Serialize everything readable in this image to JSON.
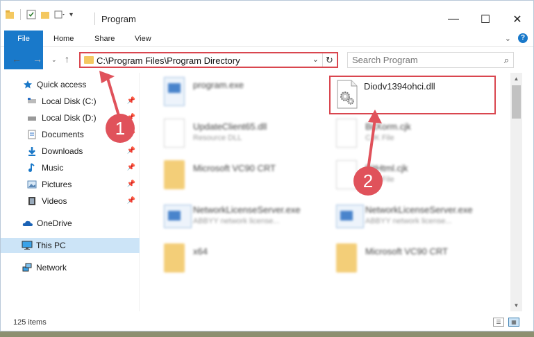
{
  "titlebar": {
    "title": "Program",
    "controls": {
      "minimize": "—",
      "maximize": "☐",
      "close": "✕"
    }
  },
  "ribbon": {
    "tabs": [
      "File",
      "Home",
      "Share",
      "View"
    ],
    "help": "?"
  },
  "address": {
    "path": "C:\\Program Files\\Program Directory",
    "refresh": "↻",
    "dropdown": "⌄"
  },
  "search": {
    "placeholder": "Search Program"
  },
  "sidebar": {
    "items": [
      {
        "label": "Quick access"
      },
      {
        "label": "Local Disk (C:)"
      },
      {
        "label": "Local Disk (D:)"
      },
      {
        "label": "Documents"
      },
      {
        "label": "Downloads"
      },
      {
        "label": "Music"
      },
      {
        "label": "Pictures"
      },
      {
        "label": "Videos"
      },
      {
        "label": "OneDrive"
      },
      {
        "label": "This PC"
      },
      {
        "label": "Network"
      }
    ]
  },
  "files": [
    {
      "name": "program.exe",
      "sub": ""
    },
    {
      "name": "Diodv1394ohci.dll",
      "sub": ""
    },
    {
      "name": "UpdateClient65.dll",
      "sub": "Resource DLL"
    },
    {
      "name": "BitXorm.cjk",
      "sub": "CJK File"
    },
    {
      "name": "Microsoft VC90 CRT",
      "sub": ""
    },
    {
      "name": "BitHtml.cjk",
      "sub": "CJK File"
    },
    {
      "name": "NetworkLicenseServer.exe",
      "sub": "ABBYY network license..."
    },
    {
      "name": "NetworkLicenseServer.exe",
      "sub": "ABBYY network license..."
    },
    {
      "name": "x64",
      "sub": ""
    },
    {
      "name": "Microsoft VC90 CRT",
      "sub": ""
    }
  ],
  "status": {
    "count": "125 items"
  },
  "annotations": {
    "marker1": "1",
    "marker2": "2"
  },
  "colors": {
    "accent": "#1979ca",
    "highlight": "#d9464f",
    "selected": "#cce4f7"
  }
}
